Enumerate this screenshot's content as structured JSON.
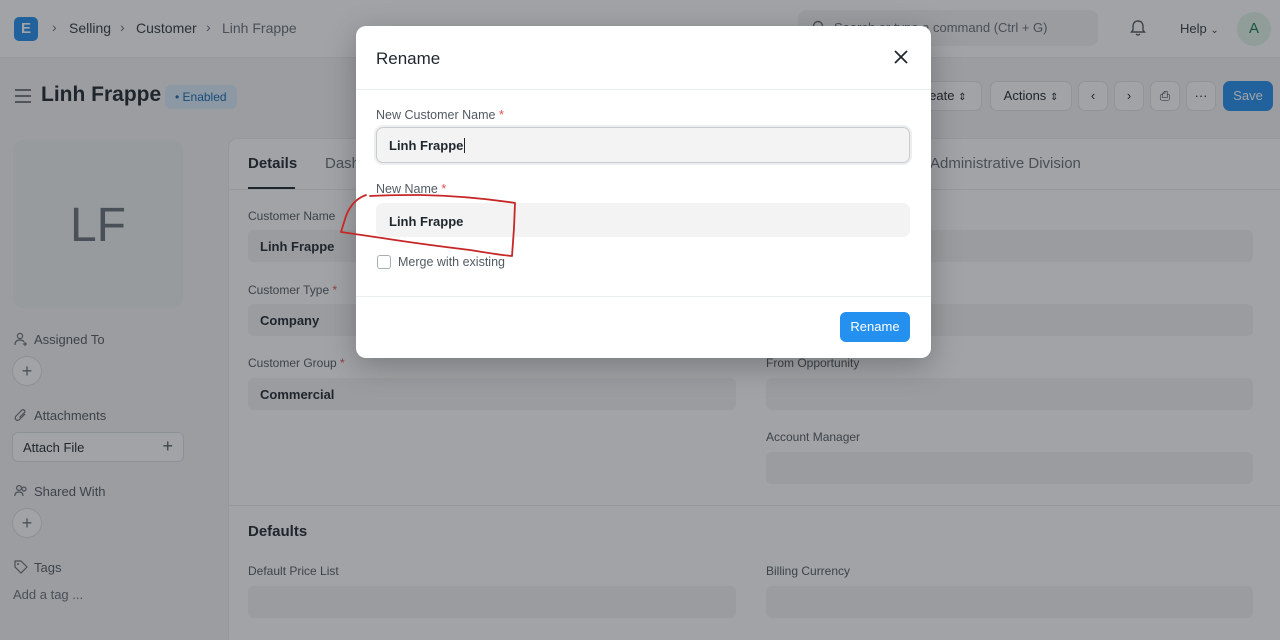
{
  "navbar": {
    "logo": "E",
    "breadcrumbs": [
      "Selling",
      "Customer",
      "Linh Frappe"
    ],
    "search_placeholder": "Search or type a command (Ctrl + G)",
    "help_label": "Help",
    "avatar_initial": "A"
  },
  "page": {
    "title": "Linh Frappe",
    "status": "• Enabled",
    "create_label": "Create",
    "actions_label": "Actions",
    "more_label": "···",
    "save_label": "Save"
  },
  "sidebar": {
    "initials": "LF",
    "assigned_to": "Assigned To",
    "attachments": "Attachments",
    "attach_file": "Attach File",
    "shared_with": "Shared With",
    "tags": "Tags",
    "add_tag": "Add a tag ..."
  },
  "tabs": [
    "Details",
    "Dashboard",
    "Administrative Division"
  ],
  "form": {
    "customer_name_label": "Customer Name",
    "customer_name_value": "Linh Frappe",
    "customer_type_label": "Customer Type",
    "customer_type_value": "Company",
    "customer_group_label": "Customer Group",
    "customer_group_value": "Commercial",
    "from_opportunity_label": "From Opportunity",
    "account_manager_label": "Account Manager",
    "defaults_title": "Defaults",
    "default_price_list_label": "Default Price List",
    "billing_currency_label": "Billing Currency"
  },
  "modal": {
    "title": "Rename",
    "new_customer_name_label": "New Customer Name",
    "new_customer_name_value": "Linh Frappe",
    "new_name_label": "New Name",
    "new_name_value": "Linh Frappe",
    "merge_label": "Merge with existing",
    "rename_button": "Rename",
    "required_mark": "*"
  },
  "colors": {
    "primary": "#2490ef",
    "annotation": "#c62828",
    "required": "#e24c4c"
  }
}
